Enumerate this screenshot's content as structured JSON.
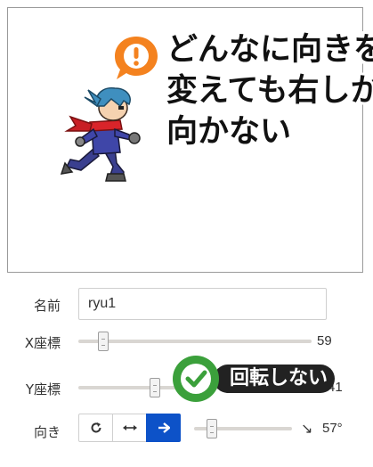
{
  "stage": {
    "caption_lines": [
      "どんなに向きを",
      "変えても右しか",
      "向かない"
    ],
    "bubble_icon": "exclamation-bubble-icon",
    "sprite_name": "ryu-ninja-running"
  },
  "form": {
    "name": {
      "label": "名前",
      "value": "ryu1"
    },
    "x": {
      "label": "X座標",
      "value": "59",
      "fraction": 0.1
    },
    "y": {
      "label": "Y座標",
      "value": "41",
      "fraction": 0.34
    },
    "direction": {
      "label": "向き",
      "buttons": [
        {
          "name": "rotate-icon",
          "glyph": "↻",
          "active": false
        },
        {
          "name": "left-right-icon",
          "glyph": "↔",
          "active": false
        },
        {
          "name": "arrow-right-icon",
          "glyph": "→",
          "active": true
        }
      ],
      "angle_arrow": "↘",
      "angle_value": "57°",
      "fraction": 0.08
    }
  },
  "tooltip": {
    "text": "回転しない",
    "icon": "check-circle-icon"
  },
  "colors": {
    "accent_orange": "#f4821f",
    "active_blue": "#0d52c8",
    "check_green": "#3ba03b",
    "tooltip_bg": "#222222"
  }
}
